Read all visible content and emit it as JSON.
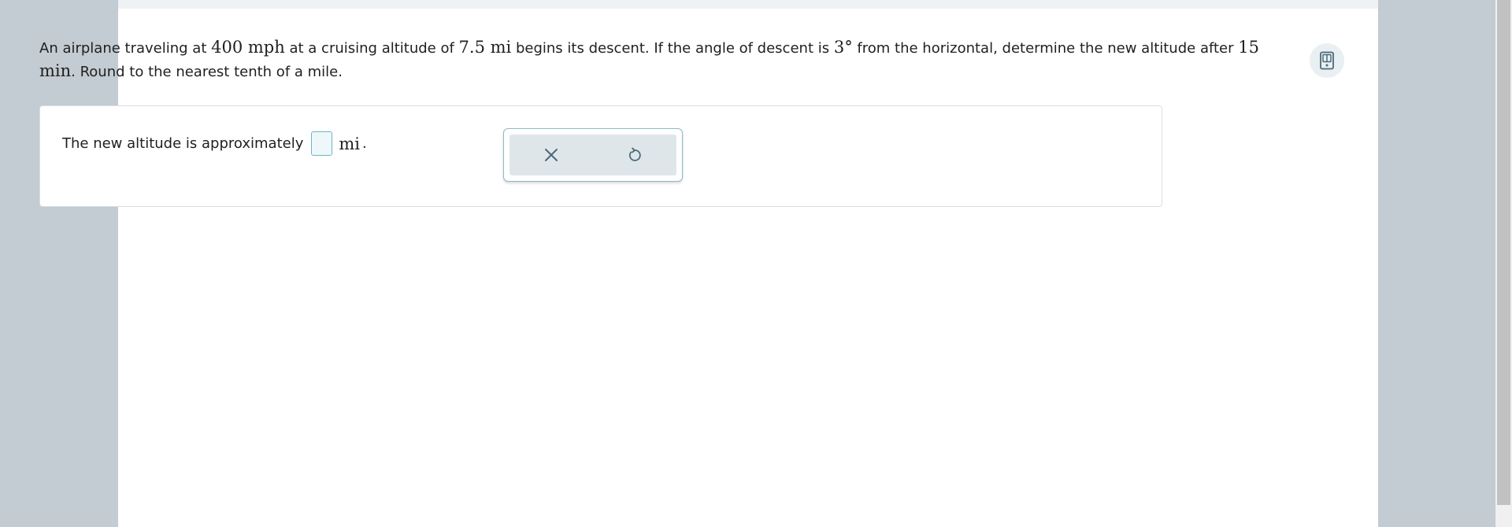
{
  "question": {
    "part1": "An airplane traveling at ",
    "speed": "400 mph",
    "part2": " at a cruising altitude of ",
    "altitude": "7.5 mi",
    "part3": " begins its descent. If the angle of descent is ",
    "angle": "3°",
    "part4": " from the horizontal, determine the new altitude after ",
    "time": "15 min",
    "part5": ". Round to the nearest tenth of a mile."
  },
  "answer": {
    "prompt": "The new altitude is approximately",
    "value": "",
    "unit": "mi",
    "period": "."
  },
  "toolbar": {
    "clear_icon": "close-icon",
    "reset_icon": "undo-icon"
  },
  "reader": {
    "icon": "book-reader-icon"
  },
  "colors": {
    "background": "#c3ccd2",
    "panel_border": "#d9dfe3",
    "input_border": "#6fb4c4",
    "toolbar_bg": "#dfe6ea",
    "icon_color": "#4b6a78"
  }
}
